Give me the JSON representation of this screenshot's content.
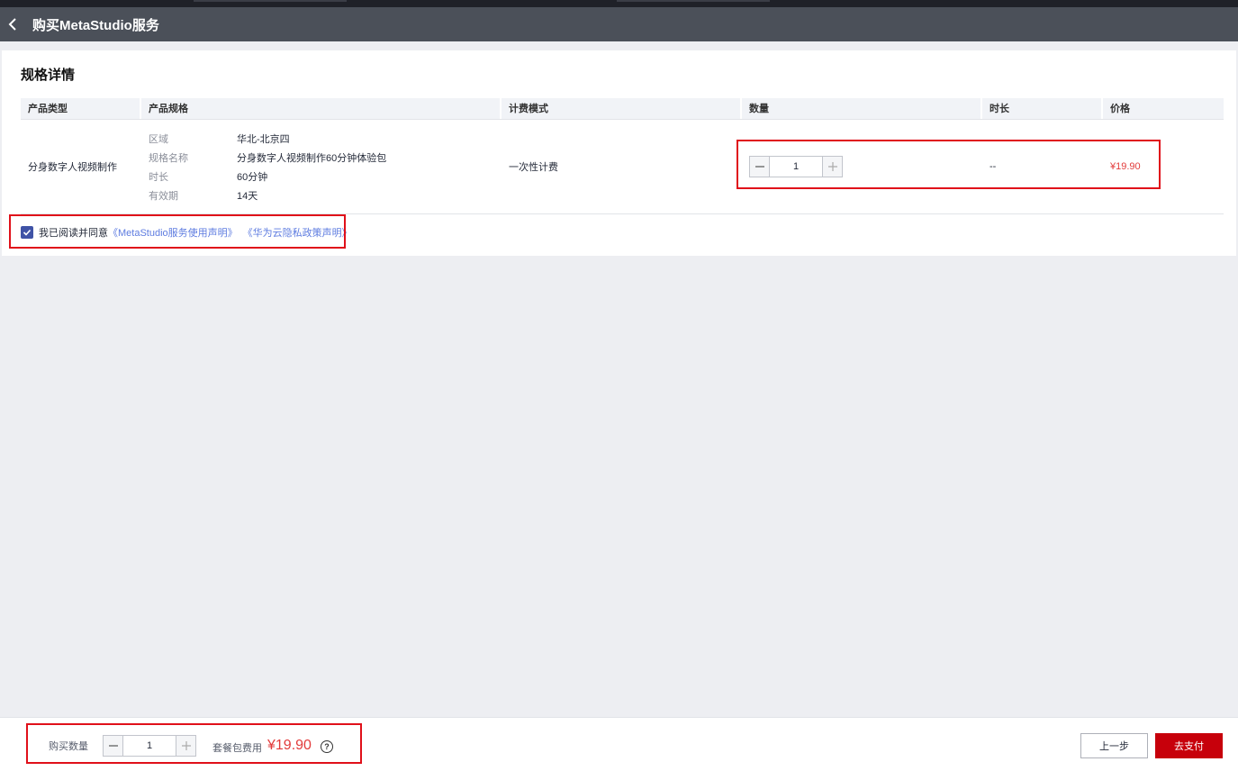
{
  "header": {
    "title": "购买MetaStudio服务"
  },
  "section": {
    "title": "规格详情"
  },
  "table": {
    "columns": [
      "产品类型",
      "产品规格",
      "计费模式",
      "数量",
      "时长",
      "价格"
    ],
    "row": {
      "product_type": "分身数字人视频制作",
      "specs": [
        {
          "key": "区域",
          "value": "华北-北京四"
        },
        {
          "key": "规格名称",
          "value": "分身数字人视频制作60分钟体验包"
        },
        {
          "key": "时长",
          "value": "60分钟"
        },
        {
          "key": "有效期",
          "value": "14天"
        }
      ],
      "billing_mode": "一次性计费",
      "quantity": "1",
      "duration": "--",
      "price": "¥19.90"
    }
  },
  "agreement": {
    "checked": true,
    "text": "我已阅读并同意",
    "link1": "《MetaStudio服务使用声明》",
    "link2": "《华为云隐私政策声明》"
  },
  "footer": {
    "quantity_label": "购买数量",
    "quantity": "1",
    "fee_label": "套餐包费用",
    "fee_value": "¥19.90",
    "prev_label": "上一步",
    "pay_label": "去支付"
  },
  "colors": {
    "header_bg": "#4b5059",
    "accent_red": "#c7000b",
    "price_red": "#e23b3b",
    "link_blue": "#5e7ce0",
    "checkbox_blue": "#3f53a6",
    "highlight_red": "#e0101a"
  }
}
